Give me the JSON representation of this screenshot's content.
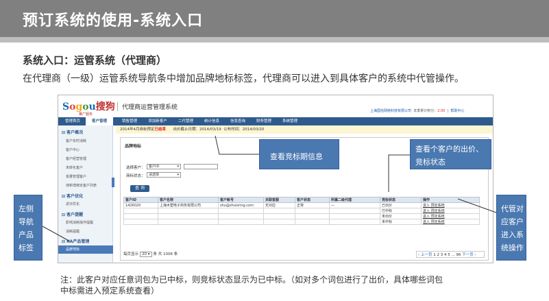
{
  "slide": {
    "title": "预订系统的使用-系统入口",
    "subtitle": "系统入口：运管系统（代理商）",
    "description": "在代理商（一级）运管系统导航条中增加品牌地标标签，代理商可以进入到具体客户的系统中代管操作。",
    "note_line1": "注：此客户对应任意词包为已中标，则竞标状态显示为已中标。（如对多个词包进行了出价，具体哪些词包",
    "note_line2": "中标需进入预定系统查看）"
  },
  "callouts": {
    "expire": "查看竞标期信息",
    "bid_line1": "查看个客户的出价、",
    "bid_line2": "竞标状态",
    "left_nav": [
      "左侧",
      "导航",
      "产品",
      "标签"
    ],
    "manage": [
      "代管对",
      "应客户",
      "进入系",
      "统操作"
    ]
  },
  "app": {
    "logo": {
      "s1": "S",
      "s2": "o",
      "s3": "g",
      "s4": "o",
      "s5": "u",
      "s6": "搜狗",
      "sub": "推广服务"
    },
    "system_title": "代理商运营管理系统",
    "user": {
      "company": "上海国信网络科技有限公司",
      "balance_label": "本季累计积分：",
      "balance_value": "2.00",
      "sep": "|",
      "help": "帮助中心"
    },
    "nav": [
      "管理首页",
      "客户管理",
      "销售管理",
      "添加新客户",
      "二代管理",
      "统计信息",
      "信息查询",
      "财务管理",
      "系统管理"
    ],
    "nav_active_index": 1,
    "sidebar": {
      "group1": "客户概况",
      "group1_items": [
        "客户实时消耗",
        "客户中心",
        "客户经营管理",
        "未转化客户",
        "批量管理客户",
        "待新增绑定客户列表"
      ],
      "group2": "客户优化",
      "group2_items": [
        "返日优化"
      ],
      "group3": "客户提醒",
      "group3_items": [
        "影响消耗操作提醒",
        "消耗提醒"
      ],
      "group4": "KA产品管理",
      "active_item": "品牌地标"
    },
    "notice": {
      "prefix": "2014年4月商标预定",
      "status": "已结束",
      "deadline": "出价截止日期：2014/03/19",
      "announce": "公布时间：2014/03/20"
    },
    "panel": {
      "title": "品牌地标",
      "customer_label": "选择客户：",
      "customer_select": "客户ID",
      "status_label": "商标状态：",
      "status_select": "请选择",
      "query_button": "查 询"
    },
    "table": {
      "headers": [
        "客户ID",
        "客户名称",
        "客户帐号",
        "关联客服",
        "客户状态",
        "所属二级代理",
        "竞标状态",
        "操作"
      ],
      "rows": [
        [
          "1426020",
          "上海木塑电子商务有限公司",
          "zhu@zhuisring.com",
          "无对应",
          "正常",
          "—",
          "已出价",
          "进入 预定系统"
        ],
        [
          "",
          "",
          "",
          "",
          "",
          "",
          "已中标",
          "进入 预定系统"
        ],
        [
          "",
          "",
          "",
          "",
          "",
          "",
          "未出价",
          "进入 预定系统"
        ],
        [
          "",
          "",
          "",
          "",
          "",
          "",
          "未中标",
          "进入 预定系统"
        ]
      ]
    },
    "pager": {
      "prefix": "每页显示",
      "per_page": "20",
      "suffix": "条  共 1006 条",
      "prev": "‹ 上一页",
      "pages": "1 2 3 4 5 ... 96",
      "next": "下一页 ›"
    }
  },
  "colors": {
    "header_gray": "#808080",
    "nav_blue": "#2e5a8e",
    "callout_blue": "#4a78b0",
    "status_red": "#dd2222"
  }
}
